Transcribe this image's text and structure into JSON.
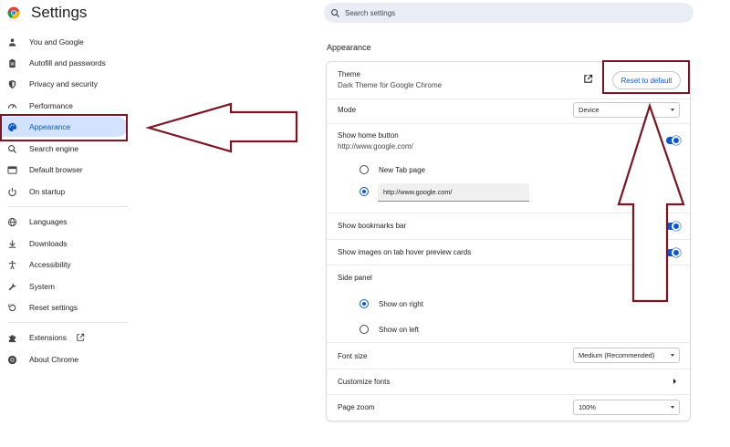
{
  "header": {
    "title": "Settings",
    "logo_icon": "chrome-logo-icon",
    "search_placeholder": "Search settings"
  },
  "sidebar": {
    "items": [
      {
        "label": "You and Google",
        "icon": "person-icon"
      },
      {
        "label": "Autofill and passwords",
        "icon": "clipboard-icon"
      },
      {
        "label": "Privacy and security",
        "icon": "shield-icon"
      },
      {
        "label": "Performance",
        "icon": "speedometer-icon"
      },
      {
        "label": "Appearance",
        "icon": "palette-icon",
        "active": true
      },
      {
        "label": "Search engine",
        "icon": "search-icon"
      },
      {
        "label": "Default browser",
        "icon": "browser-window-icon"
      },
      {
        "label": "On startup",
        "icon": "power-icon"
      },
      {
        "label": "Languages",
        "icon": "globe-icon"
      },
      {
        "label": "Downloads",
        "icon": "download-icon"
      },
      {
        "label": "Accessibility",
        "icon": "accessibility-icon"
      },
      {
        "label": "System",
        "icon": "wrench-icon"
      },
      {
        "label": "Reset settings",
        "icon": "reset-icon"
      },
      {
        "label": "Extensions",
        "icon": "puzzle-icon"
      },
      {
        "label": "About Chrome",
        "icon": "chrome-logo-icon"
      }
    ]
  },
  "appearance": {
    "section_title": "Appearance",
    "theme": {
      "label": "Theme",
      "value": "Dark Theme for Google Chrome",
      "reset_button": "Reset to default"
    },
    "mode": {
      "label": "Mode",
      "selected": "Device"
    },
    "home_button": {
      "label": "Show home button",
      "url": "http://www.google.com/",
      "enabled": true,
      "option_new_tab": "New Tab page",
      "custom_url_value": "http://www.google.com/",
      "selected_option": "custom"
    },
    "bookmarks_bar": {
      "label": "Show bookmarks bar",
      "enabled": true
    },
    "hover_cards": {
      "label": "Show images on tab hover preview cards",
      "enabled": true
    },
    "side_panel": {
      "label": "Side panel",
      "option_right": "Show on right",
      "option_left": "Show on left",
      "selected": "right"
    },
    "font_size": {
      "label": "Font size",
      "selected": "Medium (Recommended)"
    },
    "customize_fonts": {
      "label": "Customize fonts"
    },
    "page_zoom": {
      "label": "Page zoom",
      "selected": "100%"
    }
  },
  "annotation_color": "#7b1523",
  "accent_color": "#0b57d0"
}
